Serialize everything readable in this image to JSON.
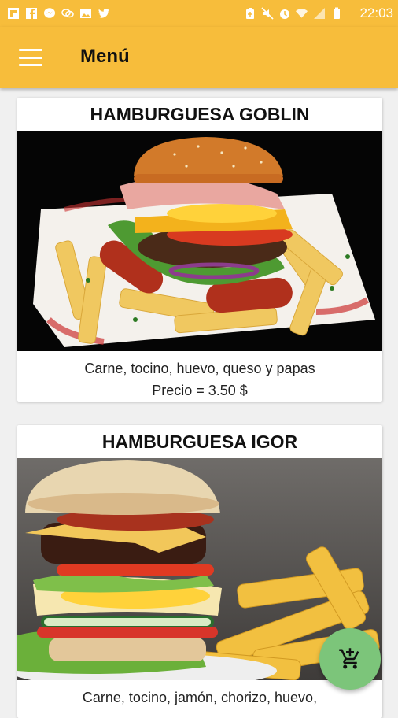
{
  "status_bar": {
    "time": "22:03",
    "left_icons": [
      "flipboard-icon",
      "facebook-icon",
      "messenger-icon",
      "chat-icon",
      "gallery-icon",
      "twitter-icon"
    ],
    "right_icons": [
      "battery-saver-icon",
      "mute-icon",
      "alarm-icon",
      "wifi-icon",
      "signal-icon",
      "battery-icon"
    ]
  },
  "app_bar": {
    "title": "Menú",
    "menu_icon": "hamburger-menu-icon",
    "background": "#f7bd3b"
  },
  "menu_items": [
    {
      "name": "HAMBURGUESA GOBLIN",
      "description": "Carne, tocino, huevo, queso y papas",
      "price": "Precio = 3.50 $"
    },
    {
      "name": "HAMBURGUESA IGOR",
      "description": "Carne, tocino, jamón, chorizo, huevo,"
    }
  ],
  "fab": {
    "icon": "add-shopping-cart-icon",
    "color": "#7cc57a"
  }
}
